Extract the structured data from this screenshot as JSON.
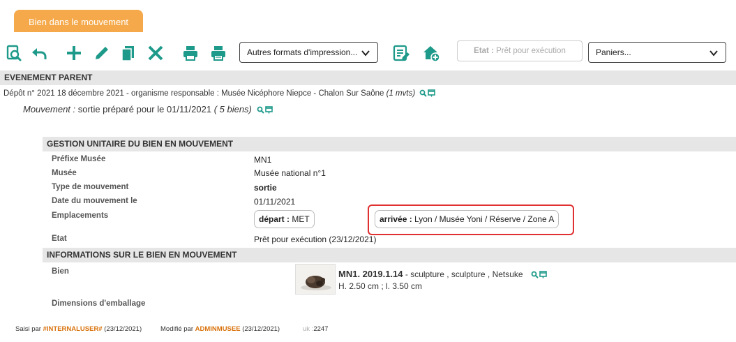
{
  "tab": {
    "label": "Bien dans le mouvement"
  },
  "toolbar": {
    "icons": [
      "search-document-icon",
      "undo-icon",
      "plus-icon",
      "pencil-icon",
      "copy-icon",
      "delete-icon",
      "print-icon",
      "print-color-icon",
      "list-edit-icon",
      "home-add-icon"
    ],
    "print_formats_select": "Autres formats d'impression...",
    "etat_label": "Etat :",
    "etat_value": "Prêt pour exécution",
    "paniers_select": "Paniers..."
  },
  "parent_event": {
    "header": "EVENEMENT PARENT",
    "depot_line": "Dépôt n° 2021 18 décembre 2021 - organisme responsable : Musée Nicéphore Niepce - Chalon Sur Saône",
    "depot_count": "(1 mvts)",
    "mouvement_label": "Mouvement :",
    "mouvement_text": "sortie préparé pour le 01/11/2021",
    "mouvement_count": "( 5 biens)"
  },
  "gestion": {
    "header": "GESTION UNITAIRE DU BIEN EN MOUVEMENT",
    "prefixe_label": "Préfixe Musée",
    "prefixe_value": "MN1",
    "musee_label": "Musée",
    "musee_value": "Musée national n°1",
    "type_label": "Type de mouvement",
    "type_value": "sortie",
    "date_label": "Date du mouvement le",
    "date_value": "01/11/2021",
    "emplacements_label": "Emplacements",
    "depart_label": "départ :",
    "depart_value": "MET",
    "arrivee_label": "arrivée :",
    "arrivee_value": "Lyon / Musée Yoni / Réserve / Zone A",
    "etat_label": "Etat",
    "etat_value": "Prêt pour exécution (23/12/2021)"
  },
  "informations": {
    "header": "INFORMATIONS SUR LE BIEN EN MOUVEMENT",
    "bien_label": "Bien",
    "bien_id": "MN1. 2019.1.14",
    "bien_desc": "- sculpture , sculpture , Netsuke",
    "bien_dims": "H. 2.50 cm ; l. 3.50 cm",
    "emballage_label": "Dimensions d'emballage"
  },
  "footer": {
    "saisi_label": "Saisi par",
    "saisi_user": "#INTERNALUSER#",
    "saisi_date": "(23/12/2021)",
    "modifie_label": "Modifié par",
    "modifie_user": "ADMINMUSEE",
    "modifie_date": "(23/12/2021)",
    "uk_label": "uk :",
    "uk_value": "2247"
  },
  "colors": {
    "accent": "#1e9a8a",
    "tab": "#f5a94a",
    "highlight": "#e03030",
    "footer_user": "#d9730d"
  }
}
